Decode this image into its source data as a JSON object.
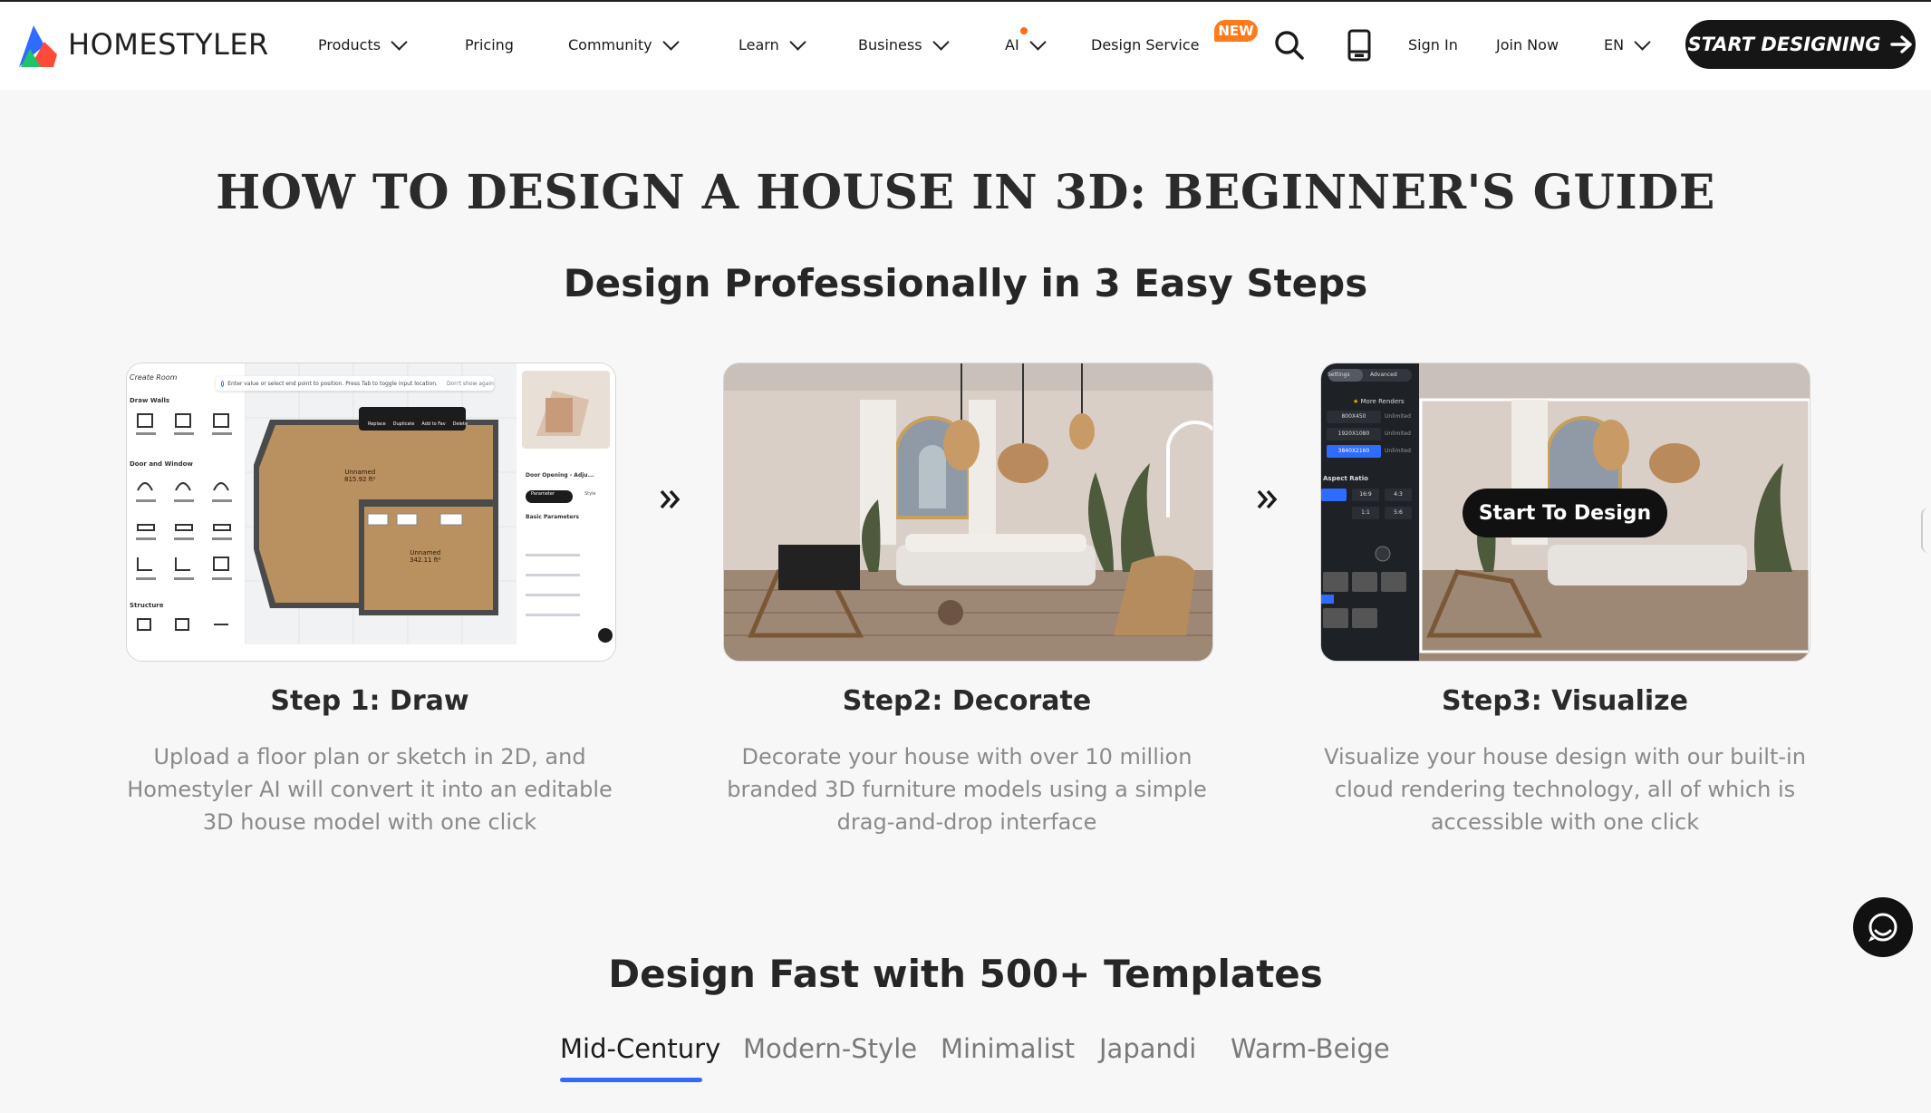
{
  "header": {
    "brand": "HOMESTYLER",
    "nav": [
      {
        "label": "Products",
        "dropdown": true
      },
      {
        "label": "Pricing",
        "dropdown": false
      },
      {
        "label": "Community",
        "dropdown": true
      },
      {
        "label": "Learn",
        "dropdown": true
      },
      {
        "label": "Business",
        "dropdown": true
      },
      {
        "label": "AI",
        "dropdown": true
      },
      {
        "label": "Design Service",
        "dropdown": false
      }
    ],
    "new_badge": "NEW",
    "sign_in": "Sign In",
    "join_now": "Join Now",
    "language": "EN",
    "cta": "START DESIGNING"
  },
  "page": {
    "title": "HOW TO DESIGN A HOUSE IN 3D: BEGINNER'S GUIDE",
    "steps_heading": "Design Professionally in 3 Easy Steps",
    "templates_heading": "Design Fast with 500+ Templates"
  },
  "steps": [
    {
      "title": "Step 1: Draw",
      "description": "Upload a floor plan or sketch in 2D, and Homestyler AI will convert it into an editable 3D house model with one click"
    },
    {
      "title": "Step2: Decorate",
      "description": "Decorate your house with over 10 million branded 3D furniture models using a simple drag-and-drop interface"
    },
    {
      "title": "Step3: Visualize",
      "description": "Visualize your house design with our built-in cloud rendering technology, all of which is accessible with one click"
    }
  ],
  "editor_preview": {
    "panel_title": "Create Room",
    "hint": "Enter value or select end point to position. Press Tab to toggle input location.",
    "dont_show": "Don't show again",
    "sections": [
      "Draw Walls",
      "Door and Window",
      "Structure"
    ],
    "room_1": "Unnamed",
    "room_1_area": "815.92 ft²",
    "room_2": "Unnamed",
    "room_2_area": "342.11 ft²",
    "props_title": "Door Opening - Adju...",
    "props_tabs": [
      "Parameter",
      "Style"
    ],
    "props_section": "Basic Parameters",
    "toolbar": [
      "Replace",
      "Duplicate",
      "Add to Fav",
      "Delete"
    ]
  },
  "render_preview": {
    "start_button": "Start To Design",
    "tabs": [
      "Settings",
      "Advanced"
    ],
    "more_renders": "More Renders",
    "resolutions": [
      "800X450",
      "1920X1080",
      "3840X2160"
    ],
    "unlimited": "Unlimited",
    "ratio_label": "Aspect Ratio",
    "ratios": [
      "16:9",
      "4:3",
      "1:1",
      "5:6"
    ]
  },
  "templates": {
    "tabs": [
      "Mid-Century",
      "Modern-Style",
      "Minimalist",
      "Japandi",
      "Warm-Beige"
    ],
    "active": "Mid-Century"
  },
  "colors": {
    "accent": "#2f6bff",
    "badge": "#ff7a1a",
    "cta_bg": "#161616",
    "page_bg": "#f7f7f8"
  }
}
